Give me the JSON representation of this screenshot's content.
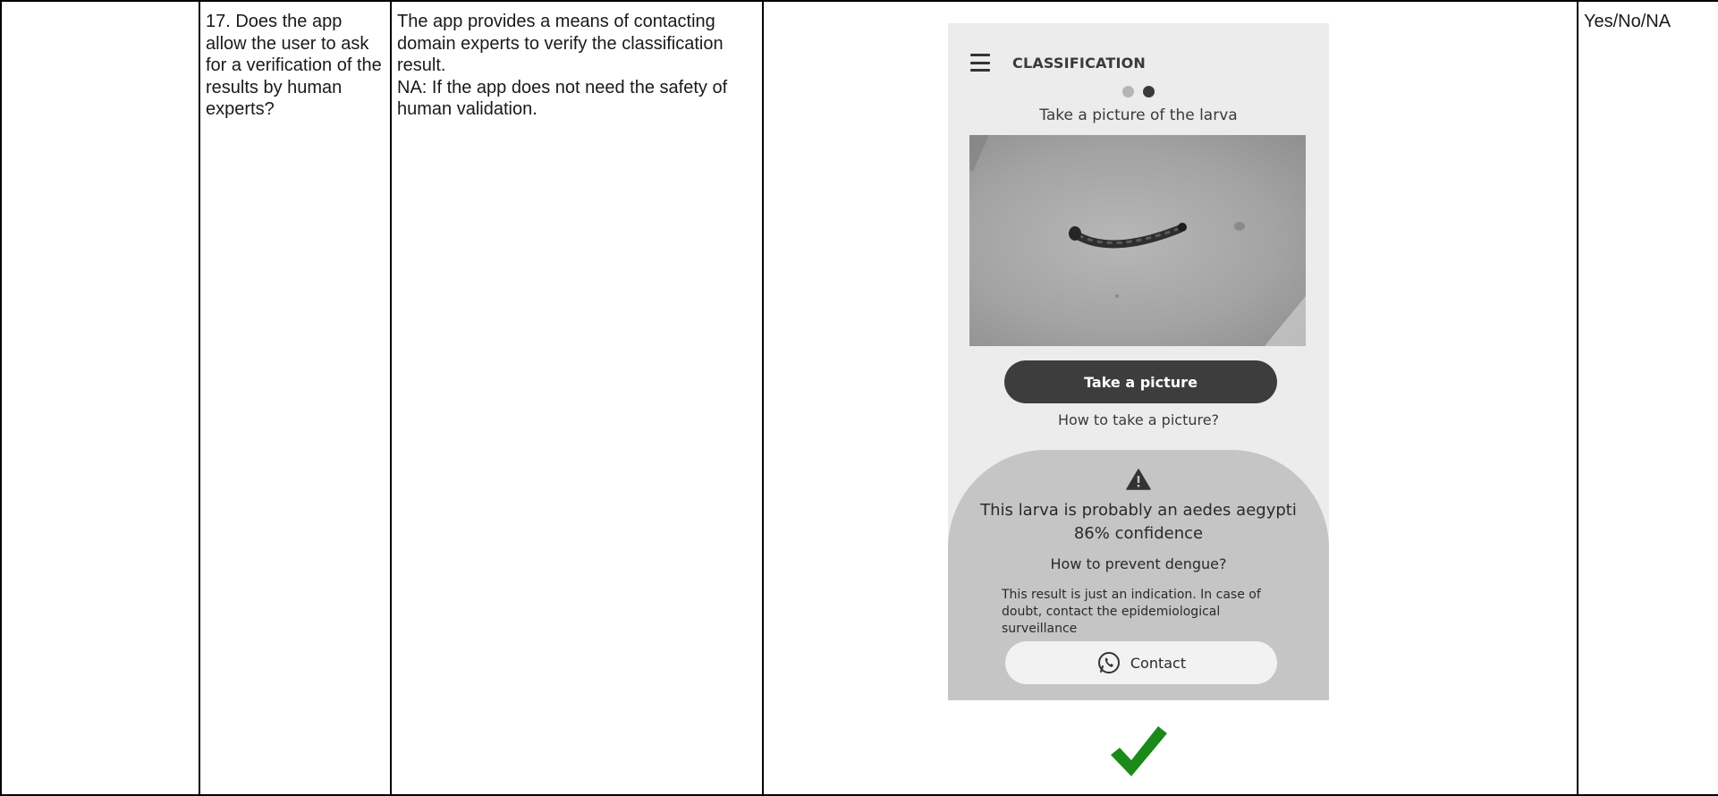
{
  "table": {
    "question": "17. Does the app allow the user to ask for a verification of the results by human experts?",
    "description_lines": [
      "The app provides a means of contacting domain experts to verify the classification result.",
      "NA: If the app does not need the safety of human validation."
    ],
    "answer_options": "Yes/No/NA"
  },
  "app": {
    "title": "CLASSIFICATION",
    "step_indicator": {
      "current": 2,
      "total": 2
    },
    "prompt": "Take a picture of the larva",
    "take_picture_button": "Take a picture",
    "how_to_link": "How to take a picture?",
    "result": {
      "line1": "This larva is probably an aedes aegypti",
      "line2": "86% confidence",
      "prevent_link": "How to prevent dengue?",
      "disclaimer": "This result is just an indication. In case of doubt, contact the epidemiological surveillance",
      "contact_button": "Contact"
    }
  },
  "icons": {
    "menu": "hamburger-menu-icon",
    "warning": "warning-triangle-icon",
    "contact": "whatsapp-phone-icon",
    "verdict": "green-check-icon"
  },
  "colors": {
    "check_green": "#1a8a1a",
    "button_dark": "#3d3d3d",
    "panel_gray": "#c5c5c5"
  }
}
